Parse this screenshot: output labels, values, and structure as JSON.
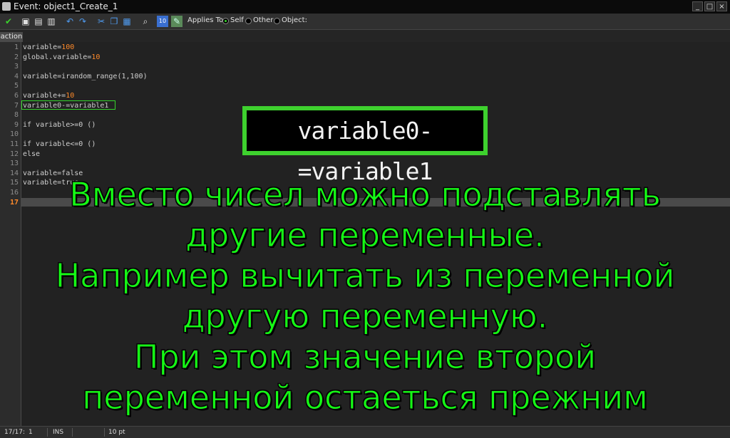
{
  "window": {
    "title": "Event: object1_Create_1",
    "minimize_label": "_",
    "maximize_label": "□",
    "close_label": "×"
  },
  "toolbar": {
    "applies_to_label": "Applies To:",
    "options": [
      {
        "label": "Self",
        "selected": true
      },
      {
        "label": "Other",
        "selected": false
      },
      {
        "label": "Object:",
        "selected": false
      }
    ],
    "icons": [
      "ok-check-icon",
      "open-icon",
      "save-icon",
      "print-icon",
      "undo-icon",
      "redo-icon",
      "cut-icon",
      "copy-icon",
      "paste-icon",
      "find-icon",
      "check-syntax-icon",
      "edit-icon"
    ]
  },
  "tabs": [
    {
      "label": "action",
      "active": true
    }
  ],
  "editor": {
    "line_numbers": [
      "1",
      "2",
      "3",
      "4",
      "5",
      "6",
      "7",
      "8",
      "9",
      "10",
      "11",
      "12",
      "13",
      "14",
      "15",
      "16",
      "17"
    ],
    "current_line": "17",
    "lines": [
      {
        "code": "variable=",
        "value": "100"
      },
      {
        "code": "global.variable=",
        "value": "10"
      },
      {
        "code": "",
        "value": ""
      },
      {
        "code": "variable=irandom_range(1,100)",
        "value": ""
      },
      {
        "code": "",
        "value": ""
      },
      {
        "code": "variable+=",
        "value": "10"
      },
      {
        "code": "variable0-=variable1",
        "value": ""
      },
      {
        "code": "",
        "value": ""
      },
      {
        "code": "if variable>=0 ()",
        "value": ""
      },
      {
        "code": "",
        "value": ""
      },
      {
        "code": "if variable<=0 ()",
        "value": ""
      },
      {
        "code": "else",
        "value": ""
      },
      {
        "code": "",
        "value": ""
      },
      {
        "code": "variable=false",
        "value": ""
      },
      {
        "code": "variable=true",
        "value": ""
      },
      {
        "code": "",
        "value": ""
      },
      {
        "code": "",
        "value": ""
      }
    ]
  },
  "zoom_snippet": "variable0-=variable1",
  "caption": [
    "Вместо чисел можно подставлять",
    "другие переменные.",
    "Например вычитать из переменной",
    "другую переменную.",
    "При этом значение второй",
    "переменной остаеться прежним"
  ],
  "status": {
    "position": "17/17:",
    "column": "1",
    "mode": "INS",
    "font_size": "10 pt"
  },
  "colors": {
    "accent_green": "#35d62c",
    "number_orange": "#ff8a2a",
    "caption_green": "#15ff15"
  }
}
